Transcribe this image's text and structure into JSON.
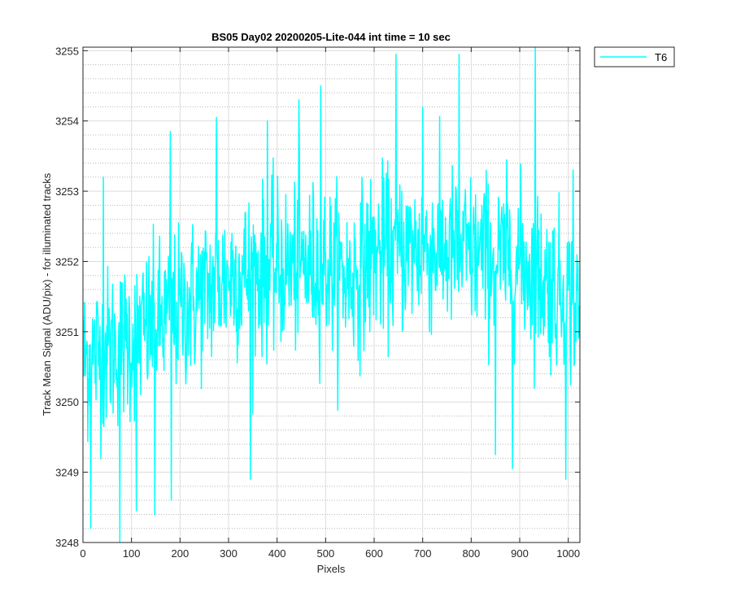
{
  "chart_data": {
    "type": "line",
    "title": "BS05 Day02 20200205-Lite-044 int time = 10 sec",
    "xlabel": "Pixels",
    "ylabel": "Track Mean Signal (ADU/pix) - for illuminated tracks",
    "xlim": [
      0,
      1024
    ],
    "ylim": [
      3248,
      3255.05
    ],
    "x_ticks": [
      0,
      100,
      200,
      300,
      400,
      500,
      600,
      700,
      800,
      900,
      1000
    ],
    "y_ticks": [
      3248,
      3249,
      3250,
      3251,
      3252,
      3253,
      3254,
      3255
    ],
    "grid": true,
    "minor_grid": true,
    "legend_position": "outside-top-right",
    "series": [
      {
        "name": "T6",
        "color": "#00FFFF",
        "trend": {
          "x": [
            0,
            100,
            200,
            300,
            400,
            500,
            550,
            600,
            700,
            800,
            900,
            1000,
            1023
          ],
          "y": [
            3250.6,
            3250.9,
            3251.3,
            3251.8,
            3251.9,
            3251.95,
            3251.75,
            3252.1,
            3252.2,
            3252.1,
            3252.0,
            3251.5,
            3251.2
          ]
        },
        "noise_std": 0.58,
        "n_points": 1024,
        "extremes": [
          {
            "x": 16,
            "y": 3248.2
          },
          {
            "x": 42,
            "y": 3253.2
          },
          {
            "x": 76,
            "y": 3248.0
          },
          {
            "x": 110,
            "y": 3248.45
          },
          {
            "x": 148,
            "y": 3248.4
          },
          {
            "x": 180,
            "y": 3253.85
          },
          {
            "x": 182,
            "y": 3248.6
          },
          {
            "x": 275,
            "y": 3254.05
          },
          {
            "x": 345,
            "y": 3248.9
          },
          {
            "x": 380,
            "y": 3254.0
          },
          {
            "x": 445,
            "y": 3254.3
          },
          {
            "x": 490,
            "y": 3254.5
          },
          {
            "x": 645,
            "y": 3254.95
          },
          {
            "x": 700,
            "y": 3254.2
          },
          {
            "x": 775,
            "y": 3254.95
          },
          {
            "x": 850,
            "y": 3249.25
          },
          {
            "x": 885,
            "y": 3249.05
          },
          {
            "x": 932,
            "y": 3255.05
          },
          {
            "x": 995,
            "y": 3248.9
          },
          {
            "x": 1010,
            "y": 3253.3
          }
        ]
      }
    ]
  }
}
